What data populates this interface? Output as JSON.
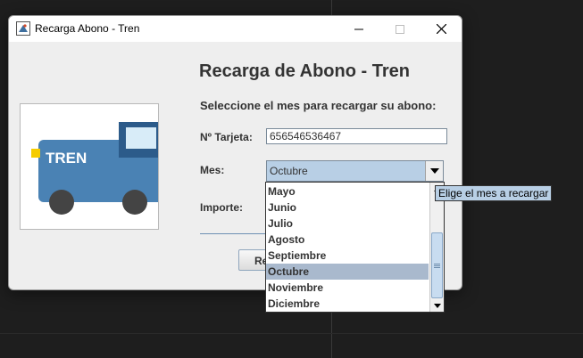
{
  "window": {
    "title": "Recarga Abono - Tren"
  },
  "form": {
    "heading": "Recarga de Abono - Tren",
    "subheading": "Seleccione el mes para recargar su abono:",
    "tarjeta_label": "Nº Tarjeta:",
    "tarjeta_value": "656546536467",
    "mes_label": "Mes:",
    "mes_value": "Octubre",
    "importe_label": "Importe:",
    "button_label_visible": "Re"
  },
  "image": {
    "train_label": "TREN"
  },
  "dropdown": {
    "items": [
      "Mayo",
      "Junio",
      "Julio",
      "Agosto",
      "Septiembre",
      "Octubre",
      "Noviembre",
      "Diciembre"
    ],
    "selected": "Octubre"
  },
  "tooltip": {
    "text": "Elige el mes a recargar"
  },
  "colors": {
    "train_body": "#4a82b4",
    "train_cab": "#2c5b8a",
    "train_window": "#d8ecf8",
    "wheels": "#444444",
    "headlight": "#f5cc00",
    "selection": "#a9b9cd",
    "tooltip_bg": "#b8cfe5"
  },
  "icons": [
    "app-icon",
    "minimize-icon",
    "maximize-icon",
    "close-icon",
    "dropdown-arrow-icon",
    "scroll-up-icon",
    "scroll-down-icon"
  ]
}
